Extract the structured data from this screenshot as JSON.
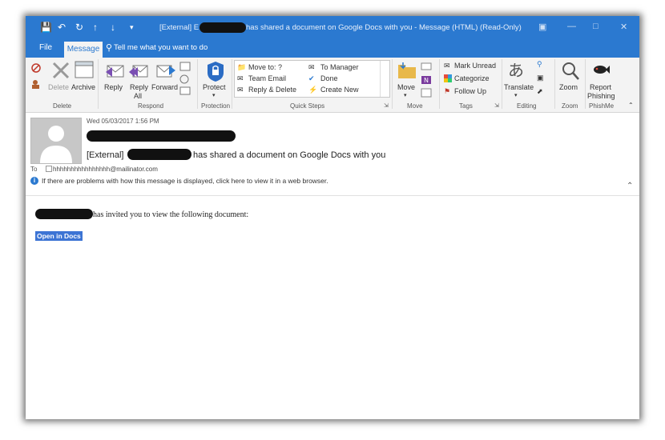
{
  "window": {
    "title_prefix": "[External] E",
    "title_suffix": "has shared a document on Google Docs with you  -  Message (HTML) (Read-Only)"
  },
  "tabs": {
    "file": "File",
    "message": "Message",
    "tell_me": "Tell me what you want to do"
  },
  "ribbon": {
    "delete_group": {
      "label": "Delete",
      "delete": "Delete",
      "archive": "Archive"
    },
    "respond_group": {
      "label": "Respond",
      "reply": "Reply",
      "reply_all_1": "Reply",
      "reply_all_2": "All",
      "forward": "Forward"
    },
    "protection_group": {
      "label": "Protection",
      "protect": "Protect"
    },
    "quick_steps": {
      "label": "Quick Steps",
      "items": [
        "Move to: ?",
        "Team Email",
        "Reply & Delete",
        "To Manager",
        "Done",
        "Create New"
      ]
    },
    "move_group": {
      "label": "Move",
      "move": "Move"
    },
    "tags_group": {
      "label": "Tags",
      "mark_unread": "Mark Unread",
      "categorize": "Categorize",
      "follow_up": "Follow Up"
    },
    "editing_group": {
      "label": "Editing",
      "translate": "Translate"
    },
    "zoom_group": {
      "label": "Zoom",
      "zoom": "Zoom"
    },
    "phishme_group": {
      "label": "PhishMe",
      "report_1": "Report",
      "report_2": "Phishing"
    }
  },
  "message": {
    "datetime": "Wed 05/03/2017 1:56 PM",
    "subject_prefix": "[External]",
    "subject_suffix": "has shared a document on Google Docs with you",
    "to_label": "To",
    "to_address": "hhhhhhhhhhhhhhhh@mailinator.com",
    "info_bar": "If there are problems with how this message is displayed, click here to view it in a web browser.",
    "body_text": "has invited you to view the following document:",
    "open_link": "Open in Docs"
  },
  "colors": {
    "accent": "#2b79d0",
    "selection": "#3c74d4"
  }
}
